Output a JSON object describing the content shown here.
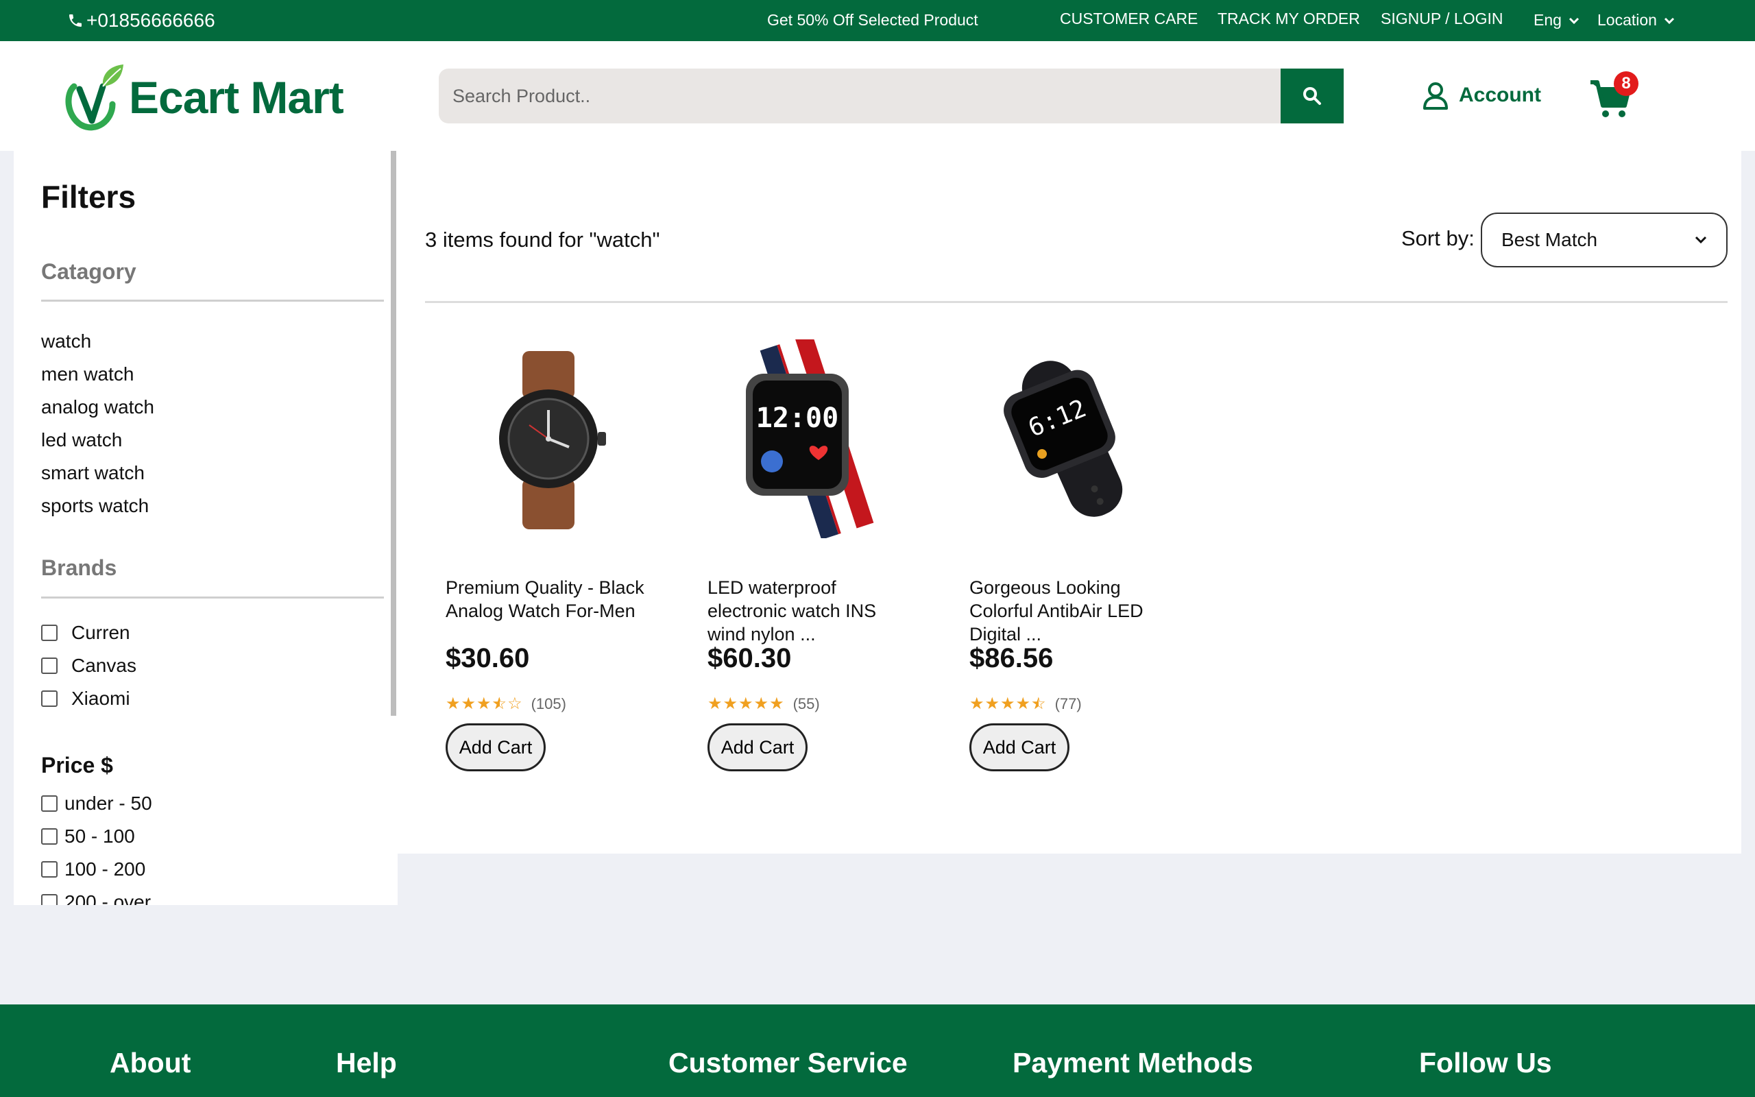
{
  "topbar": {
    "phone": "+01856666666",
    "promo": "Get 50% Off Selected Product",
    "links": [
      "CUSTOMER CARE",
      "TRACK MY ORDER",
      "SIGNUP / LOGIN"
    ],
    "language": "Eng",
    "location": "Location"
  },
  "header": {
    "logo": "Ecart Mart",
    "search_placeholder": "Search Product..",
    "account": "Account",
    "cart_count": "8"
  },
  "filters": {
    "title": "Filters",
    "category_title": "Catagory",
    "categories": [
      "watch",
      "men watch",
      "analog watch",
      "led watch",
      "smart watch",
      "sports watch"
    ],
    "brands_title": "Brands",
    "brands": [
      "Curren",
      "Canvas",
      "Xiaomi"
    ],
    "price_title": "Price $",
    "prices": [
      "under - 50",
      "50 - 100",
      "100 - 200",
      "200 - over"
    ]
  },
  "results": {
    "summary": "3 items found for \"watch\"",
    "sort_label": "Sort by:",
    "sort_value": "Best Match"
  },
  "products": [
    {
      "name": "Premium Quality - Black Analog Watch For-Men",
      "price": "$30.60",
      "rating": 3.5,
      "reviews": "(105)",
      "button": "Add Cart",
      "image": "analog-watch-brown-strap"
    },
    {
      "name": "LED waterproof electronic watch INS wind nylon ...",
      "price": "$60.30",
      "rating": 5,
      "reviews": "(55)",
      "button": "Add Cart",
      "image": "smart-watch-striped-strap"
    },
    {
      "name": "Gorgeous Looking Colorful AntibAir LED Digital ...",
      "price": "$86.56",
      "rating": 4.5,
      "reviews": "(77)",
      "button": "Add Cart",
      "image": "led-watch-black-strap"
    }
  ],
  "footer": {
    "headings": [
      "About",
      "Help",
      "Customer Service",
      "Payment Methods",
      "Follow Us"
    ]
  },
  "colors": {
    "brand_green": "#036a3d",
    "badge_red": "#e21b1b",
    "star": "#f0a020"
  }
}
